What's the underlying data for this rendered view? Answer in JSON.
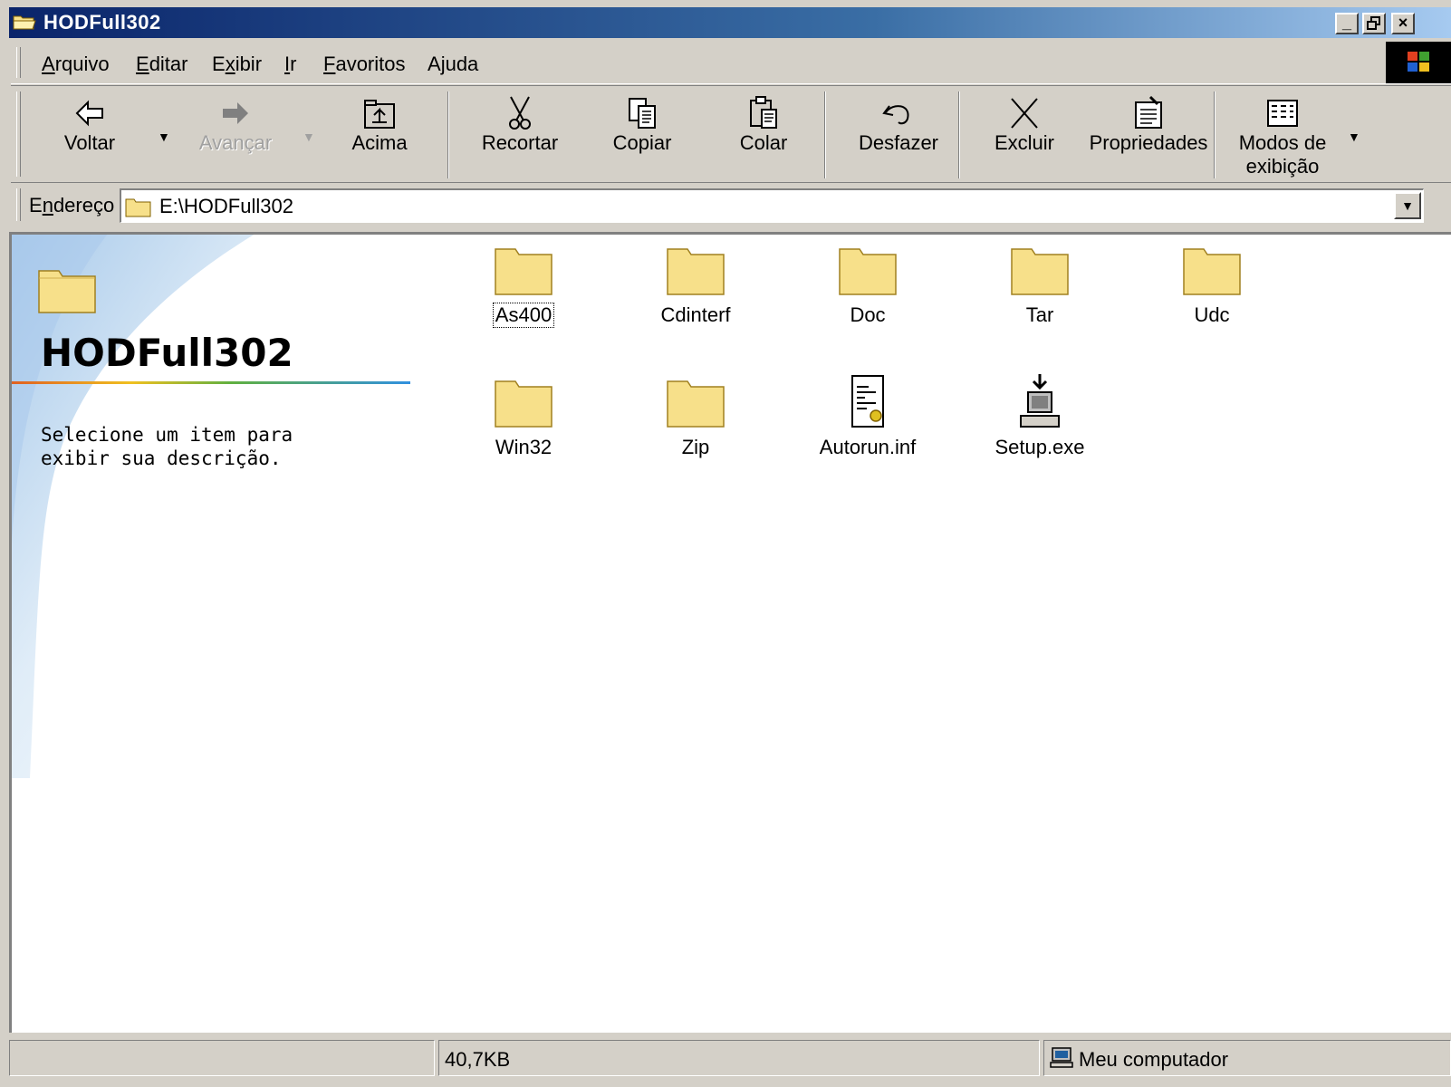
{
  "window": {
    "title": "HODFull302",
    "controls": [
      "_",
      "▫",
      "×"
    ]
  },
  "menu": {
    "items": [
      {
        "label": "Arquivo",
        "key": "A",
        "rest": "rquivo"
      },
      {
        "label": "Editar",
        "key": "E",
        "rest": "ditar"
      },
      {
        "label": "Exibir",
        "pre": "E",
        "key": "x",
        "rest": "ibir"
      },
      {
        "label": "Ir",
        "key": "I",
        "rest": "r"
      },
      {
        "label": "Favoritos",
        "key": "F",
        "rest": "avoritos"
      },
      {
        "label": "Ajuda",
        "pre": "A",
        "key": "j",
        "rest": "uda"
      }
    ]
  },
  "toolbar": {
    "back": "Voltar",
    "forward": "Avançar",
    "up": "Acima",
    "cut": "Recortar",
    "copy": "Copiar",
    "paste": "Colar",
    "undo": "Desfazer",
    "delete": "Excluir",
    "properties": "Propriedades",
    "views_line1": "Modos de",
    "views_line2": "exibição"
  },
  "address": {
    "label_pre": "E",
    "label_key": "n",
    "label_rest": "dereço",
    "value": "E:\\HODFull302"
  },
  "webview": {
    "title": "HODFull302",
    "description": "Selecione um item para exibir sua descrição."
  },
  "files": [
    {
      "name": "As400",
      "type": "folder"
    },
    {
      "name": "Cdinterf",
      "type": "folder"
    },
    {
      "name": "Doc",
      "type": "folder"
    },
    {
      "name": "Tar",
      "type": "folder"
    },
    {
      "name": "Udc",
      "type": "folder"
    },
    {
      "name": "Win32",
      "type": "folder"
    },
    {
      "name": "Zip",
      "type": "folder"
    },
    {
      "name": "Autorun.inf",
      "type": "inf-file"
    },
    {
      "name": "Setup.exe",
      "type": "installer"
    }
  ],
  "status": {
    "size": "40,7KB",
    "zone": "Meu computador"
  },
  "colors": {
    "titlebar_start": "#0a246a",
    "titlebar_end": "#a6caf0",
    "face": "#d4d0c8",
    "folder": "#f7e08a"
  }
}
